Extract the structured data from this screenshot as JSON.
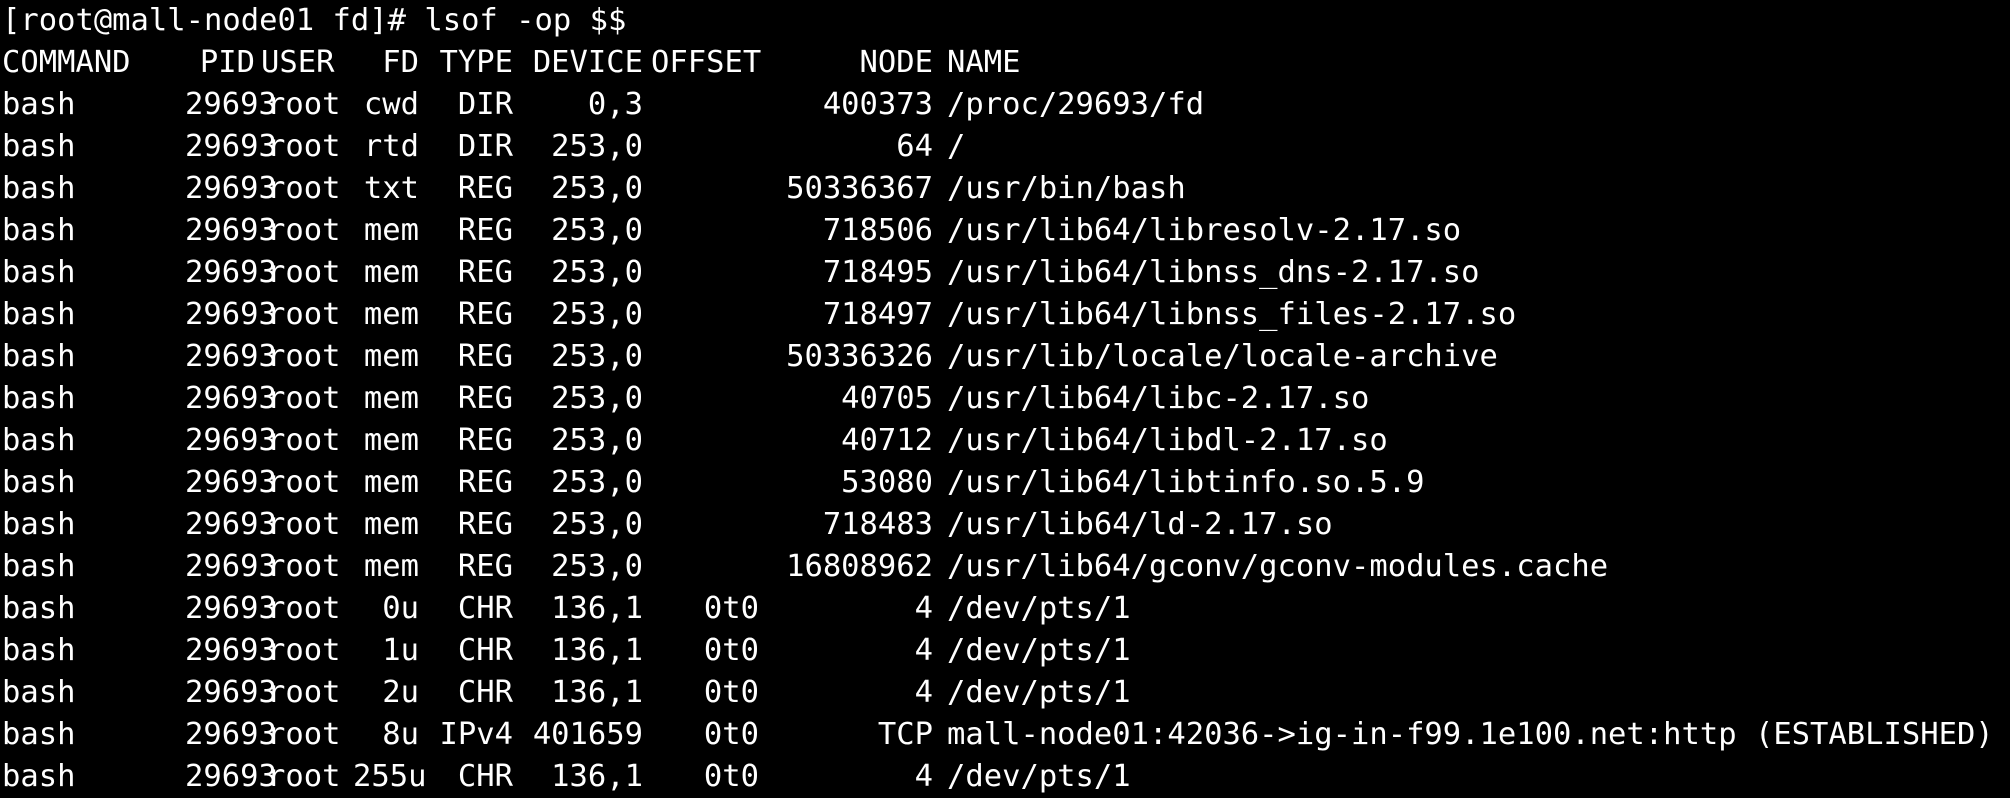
{
  "terminal": {
    "prompt": "[root@mall-node01 fd]# lsof -op $$",
    "colors": {
      "background": "#000000",
      "foreground": "#ffffff"
    },
    "headers": {
      "command": "COMMAND",
      "pid": "PID",
      "user": "USER",
      "fd": "FD",
      "type": "TYPE",
      "device": "DEVICE",
      "offset": "OFFSET",
      "node": "NODE",
      "name": "NAME"
    },
    "rows": [
      {
        "command": "bash",
        "pid": "29693",
        "user": "root",
        "fd": "cwd",
        "type": "DIR",
        "device": "0,3",
        "offset": "",
        "node": "400373",
        "name": "/proc/29693/fd"
      },
      {
        "command": "bash",
        "pid": "29693",
        "user": "root",
        "fd": "rtd",
        "type": "DIR",
        "device": "253,0",
        "offset": "",
        "node": "64",
        "name": "/"
      },
      {
        "command": "bash",
        "pid": "29693",
        "user": "root",
        "fd": "txt",
        "type": "REG",
        "device": "253,0",
        "offset": "",
        "node": "50336367",
        "name": "/usr/bin/bash"
      },
      {
        "command": "bash",
        "pid": "29693",
        "user": "root",
        "fd": "mem",
        "type": "REG",
        "device": "253,0",
        "offset": "",
        "node": "718506",
        "name": "/usr/lib64/libresolv-2.17.so"
      },
      {
        "command": "bash",
        "pid": "29693",
        "user": "root",
        "fd": "mem",
        "type": "REG",
        "device": "253,0",
        "offset": "",
        "node": "718495",
        "name": "/usr/lib64/libnss_dns-2.17.so"
      },
      {
        "command": "bash",
        "pid": "29693",
        "user": "root",
        "fd": "mem",
        "type": "REG",
        "device": "253,0",
        "offset": "",
        "node": "718497",
        "name": "/usr/lib64/libnss_files-2.17.so"
      },
      {
        "command": "bash",
        "pid": "29693",
        "user": "root",
        "fd": "mem",
        "type": "REG",
        "device": "253,0",
        "offset": "",
        "node": "50336326",
        "name": "/usr/lib/locale/locale-archive"
      },
      {
        "command": "bash",
        "pid": "29693",
        "user": "root",
        "fd": "mem",
        "type": "REG",
        "device": "253,0",
        "offset": "",
        "node": "40705",
        "name": "/usr/lib64/libc-2.17.so"
      },
      {
        "command": "bash",
        "pid": "29693",
        "user": "root",
        "fd": "mem",
        "type": "REG",
        "device": "253,0",
        "offset": "",
        "node": "40712",
        "name": "/usr/lib64/libdl-2.17.so"
      },
      {
        "command": "bash",
        "pid": "29693",
        "user": "root",
        "fd": "mem",
        "type": "REG",
        "device": "253,0",
        "offset": "",
        "node": "53080",
        "name": "/usr/lib64/libtinfo.so.5.9"
      },
      {
        "command": "bash",
        "pid": "29693",
        "user": "root",
        "fd": "mem",
        "type": "REG",
        "device": "253,0",
        "offset": "",
        "node": "718483",
        "name": "/usr/lib64/ld-2.17.so"
      },
      {
        "command": "bash",
        "pid": "29693",
        "user": "root",
        "fd": "mem",
        "type": "REG",
        "device": "253,0",
        "offset": "",
        "node": "16808962",
        "name": "/usr/lib64/gconv/gconv-modules.cache"
      },
      {
        "command": "bash",
        "pid": "29693",
        "user": "root",
        "fd": "0u",
        "type": "CHR",
        "device": "136,1",
        "offset": "0t0",
        "node": "4",
        "name": "/dev/pts/1"
      },
      {
        "command": "bash",
        "pid": "29693",
        "user": "root",
        "fd": "1u",
        "type": "CHR",
        "device": "136,1",
        "offset": "0t0",
        "node": "4",
        "name": "/dev/pts/1"
      },
      {
        "command": "bash",
        "pid": "29693",
        "user": "root",
        "fd": "2u",
        "type": "CHR",
        "device": "136,1",
        "offset": "0t0",
        "node": "4",
        "name": "/dev/pts/1"
      },
      {
        "command": "bash",
        "pid": "29693",
        "user": "root",
        "fd": "8u",
        "type": "IPv4",
        "device": "401659",
        "offset": "0t0",
        "node": "TCP",
        "name": "mall-node01:42036->ig-in-f99.1e100.net:http (ESTABLISHED)"
      },
      {
        "command": "bash",
        "pid": "29693",
        "user": "root",
        "fd": "255u",
        "type": "CHR",
        "device": "136,1",
        "offset": "0t0",
        "node": "4",
        "name": "/dev/pts/1"
      }
    ]
  }
}
